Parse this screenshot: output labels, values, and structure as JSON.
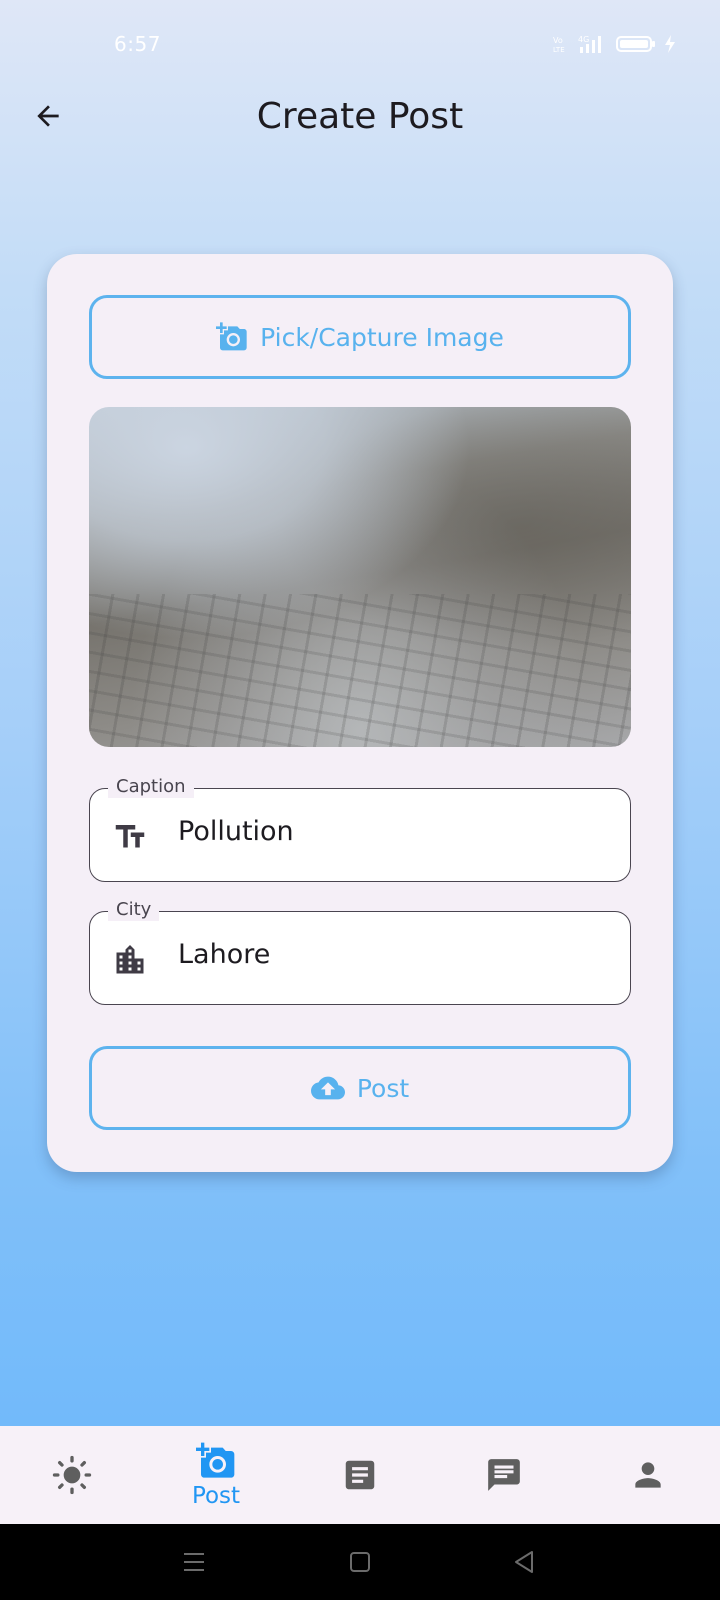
{
  "status_bar": {
    "time": "6:57",
    "volte": "Vo LTE",
    "network": "4G",
    "icons": [
      "volte-icon",
      "signal-4g-icon",
      "battery-icon",
      "charging-icon"
    ]
  },
  "app_bar": {
    "title": "Create Post",
    "back_icon": "arrow-back-icon"
  },
  "form": {
    "pick_image_label": "Pick/Capture Image",
    "pick_image_icon": "add-a-photo-icon",
    "image_preview": "selected-photo",
    "caption": {
      "label": "Caption",
      "value": "Pollution",
      "icon": "text-fields-icon"
    },
    "city": {
      "label": "City",
      "value": "Lahore",
      "icon": "location-city-icon"
    },
    "post_label": "Post",
    "post_icon": "cloud-upload-icon"
  },
  "bottom_nav": {
    "items": [
      {
        "icon": "sun-icon",
        "label": ""
      },
      {
        "icon": "add-a-photo-icon",
        "label": "Post",
        "selected": true
      },
      {
        "icon": "article-icon",
        "label": ""
      },
      {
        "icon": "chat-icon",
        "label": ""
      },
      {
        "icon": "person-icon",
        "label": ""
      }
    ]
  },
  "colors": {
    "accent": "#58b2ee",
    "nav_selected": "#2196f3",
    "card_bg": "#f5eff7",
    "icon_gray": "#5f5f5f"
  }
}
